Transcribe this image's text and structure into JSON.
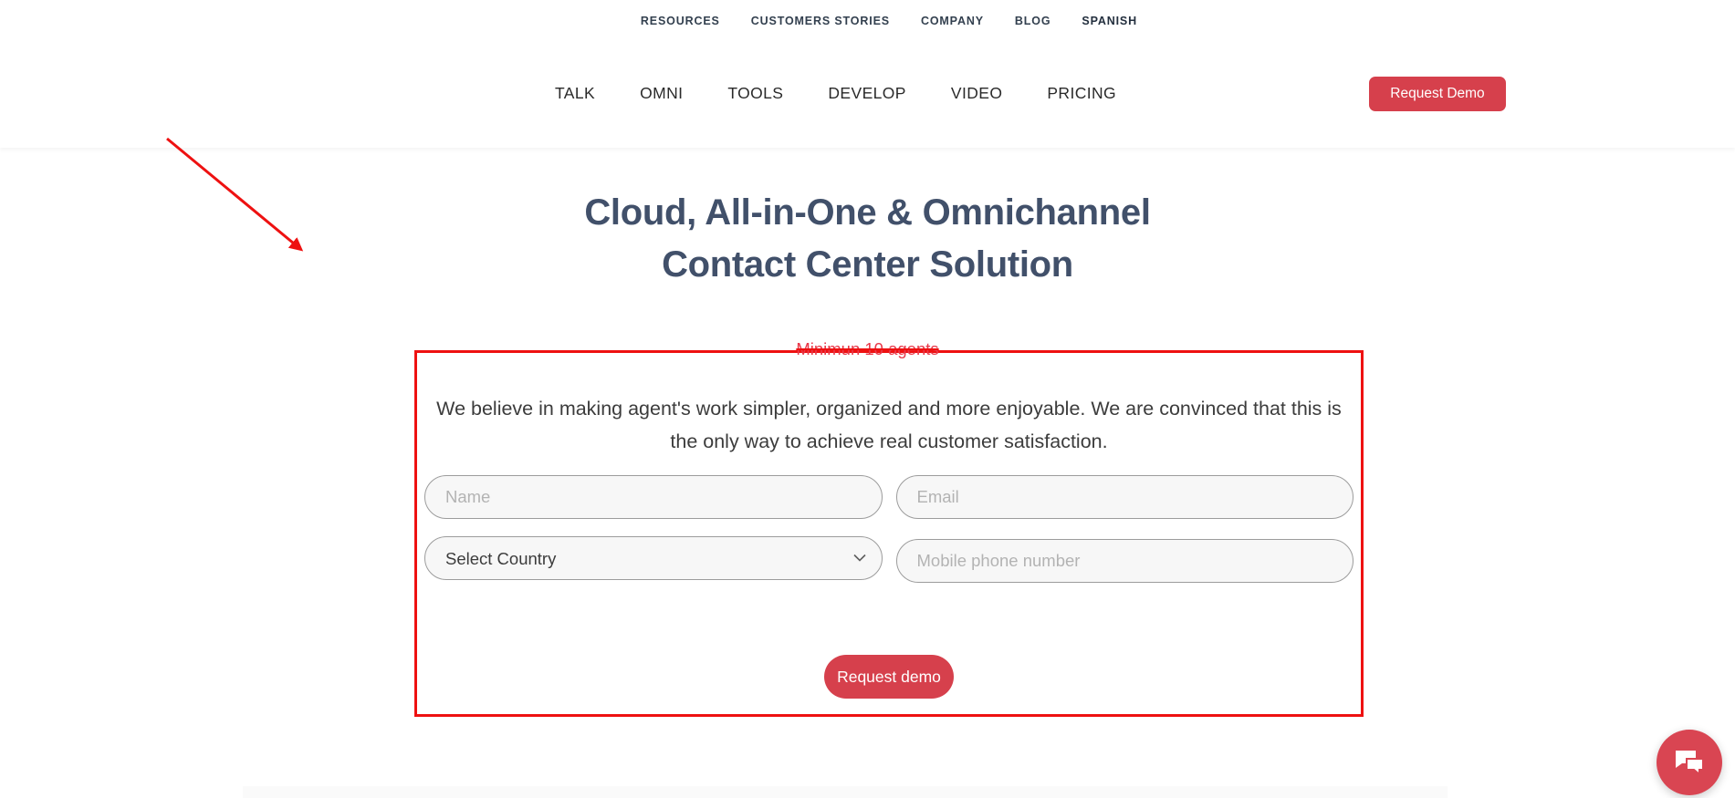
{
  "header": {
    "topnav": [
      {
        "label": "RESOURCES",
        "bold": false
      },
      {
        "label": "CUSTOMERS STORIES",
        "bold": false
      },
      {
        "label": "COMPANY",
        "bold": false
      },
      {
        "label": "BLOG",
        "bold": false
      },
      {
        "label": "SPANISH",
        "bold": true
      }
    ],
    "mainnav": [
      {
        "label": "TALK"
      },
      {
        "label": "OMNI"
      },
      {
        "label": "TOOLS"
      },
      {
        "label": "DEVELOP"
      },
      {
        "label": "VIDEO"
      },
      {
        "label": "PRICING"
      }
    ],
    "cta_label": "Request Demo"
  },
  "hero": {
    "title_line1": "Cloud, All-in-One & Omnichannel",
    "title_line2": "Contact Center Solution"
  },
  "annotation": {
    "strike_text": "Minimun 10 agents",
    "box_color": "#ee1111",
    "arrow_color": "#ee1111"
  },
  "form": {
    "lead_text": "We believe in making agent's work simpler, organized and more enjoyable. We are convinced that this is the only way to achieve real customer satisfaction.",
    "name_placeholder": "Name",
    "name_value": "",
    "email_placeholder": "Email",
    "email_value": "",
    "country_selected": "Select Country",
    "country_options": [
      "Select Country"
    ],
    "phone_placeholder": "Mobile phone number",
    "phone_value": "",
    "submit_label": "Request demo"
  },
  "chat": {
    "icon": "chat-bubble-icon"
  },
  "colors": {
    "brand_red": "#d6404c",
    "annotation_red": "#ee1111",
    "heading_slate": "#41506a"
  }
}
